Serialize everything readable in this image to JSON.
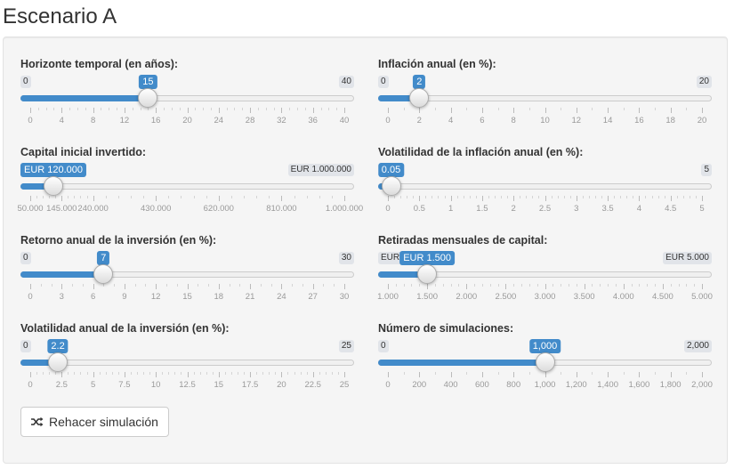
{
  "page": {
    "title": "Escenario A"
  },
  "sliders": [
    {
      "id": "horizonte",
      "label": "Horizonte temporal (en años):",
      "min_label": "0",
      "max_label": "40",
      "value_label": "15",
      "fraction": 0.375,
      "ticks": [
        "0",
        "4",
        "8",
        "12",
        "16",
        "20",
        "24",
        "28",
        "32",
        "36",
        "40"
      ],
      "minor_per_major": 3
    },
    {
      "id": "inflacion",
      "label": "Inflación anual (en %):",
      "min_label": "0",
      "max_label": "20",
      "value_label": "2",
      "fraction": 0.1,
      "ticks": [
        "0",
        "2",
        "4",
        "6",
        "8",
        "10",
        "12",
        "14",
        "16",
        "18",
        "20"
      ],
      "minor_per_major": 1
    },
    {
      "id": "capital",
      "label": "Capital inicial invertido:",
      "min_label": "EUR 50.000",
      "max_label": "EUR 1.000.000",
      "value_label": "EUR 120.000",
      "fraction": 0.0737,
      "ticks": [
        "50.000",
        "145.000",
        "240.000",
        "430.000",
        "620.000",
        "810.000",
        "1.000.000"
      ],
      "tick_fracs": [
        0,
        0.1,
        0.2,
        0.4,
        0.6,
        0.8,
        1.0
      ],
      "minor_per_major": 4
    },
    {
      "id": "vol_inflacion",
      "label": "Volatilidad de la inflación anual (en %):",
      "min_label": "0",
      "max_label": "5",
      "value_label": "0.05",
      "fraction": 0.01,
      "ticks": [
        "0",
        "0.5",
        "1",
        "1.5",
        "2",
        "2.5",
        "3",
        "3.5",
        "4",
        "4.5",
        "5"
      ],
      "minor_per_major": 4
    },
    {
      "id": "retorno",
      "label": "Retorno anual de la inversión (en %):",
      "min_label": "0",
      "max_label": "30",
      "value_label": "7",
      "fraction": 0.2333,
      "ticks": [
        "0",
        "3",
        "6",
        "9",
        "12",
        "15",
        "18",
        "21",
        "24",
        "27",
        "30"
      ],
      "minor_per_major": 2
    },
    {
      "id": "retiradas",
      "label": "Retiradas mensuales de capital:",
      "min_label": "EUR 1.000",
      "max_label": "EUR 5.000",
      "value_label": "EUR 1.500",
      "fraction": 0.125,
      "ticks": [
        "1.000",
        "1.500",
        "2.000",
        "2.500",
        "3.000",
        "3.500",
        "4.000",
        "4.500",
        "5.000"
      ],
      "minor_per_major": 4
    },
    {
      "id": "vol_inversion",
      "label": "Volatilidad anual de la inversión (en %):",
      "min_label": "0",
      "max_label": "25",
      "value_label": "2.2",
      "fraction": 0.088,
      "ticks": [
        "0",
        "2.5",
        "5",
        "7.5",
        "10",
        "12.5",
        "15",
        "17.5",
        "20",
        "22.5",
        "25"
      ],
      "minor_per_major": 4
    },
    {
      "id": "simulaciones",
      "label": "Número de simulaciones:",
      "min_label": "0",
      "max_label": "2,000",
      "value_label": "1,000",
      "fraction": 0.5,
      "ticks": [
        "0",
        "200",
        "400",
        "600",
        "800",
        "1,000",
        "1,200",
        "1,400",
        "1,600",
        "1,800",
        "2,000"
      ],
      "minor_per_major": 1
    }
  ],
  "button": {
    "label": "Rehacer simulación",
    "icon": "shuffle-icon"
  },
  "colors": {
    "accent": "#428bca",
    "track": "#f0f0f0",
    "panel": "#f5f5f5"
  }
}
